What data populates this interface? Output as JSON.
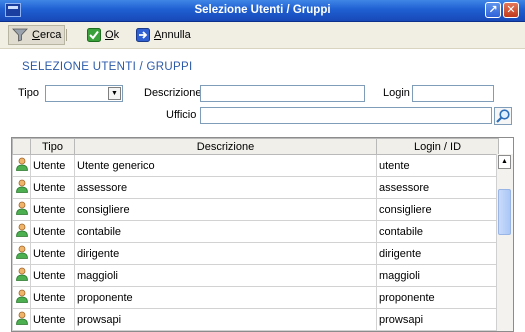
{
  "window": {
    "title": "Selezione Utenti / Gruppi",
    "restore": "↗",
    "close": "✕"
  },
  "toolbar": {
    "search_mnemonic": "C",
    "search_rest": "erca",
    "ok_mnemonic": "O",
    "ok_rest": "k",
    "cancel_mnemonic": "A",
    "cancel_rest": "nnulla"
  },
  "form": {
    "section_title": "SELEZIONE UTENTI / GRUPPI",
    "tipo_label": "Tipo",
    "tipo_value": "",
    "descrizione_label": "Descrizione",
    "descrizione_value": "",
    "login_label": "Login",
    "login_value": "",
    "ufficio_label": "Ufficio",
    "ufficio_value": ""
  },
  "grid": {
    "columns": [
      "",
      "Tipo",
      "Descrizione",
      "Login / ID"
    ],
    "rows": [
      {
        "tipo": "Utente",
        "descrizione": "Utente generico",
        "login": "utente"
      },
      {
        "tipo": "Utente",
        "descrizione": "assessore",
        "login": "assessore"
      },
      {
        "tipo": "Utente",
        "descrizione": "consigliere",
        "login": "consigliere"
      },
      {
        "tipo": "Utente",
        "descrizione": "contabile",
        "login": "contabile"
      },
      {
        "tipo": "Utente",
        "descrizione": "dirigente",
        "login": "dirigente"
      },
      {
        "tipo": "Utente",
        "descrizione": "maggioli",
        "login": "maggioli"
      },
      {
        "tipo": "Utente",
        "descrizione": "proponente",
        "login": "proponente"
      },
      {
        "tipo": "Utente",
        "descrizione": "prowsapi",
        "login": "prowsapi"
      }
    ],
    "row_icon": "user-icon"
  },
  "colors": {
    "accent": "#2c5aa8",
    "titlebar": "#1f5fd1"
  }
}
